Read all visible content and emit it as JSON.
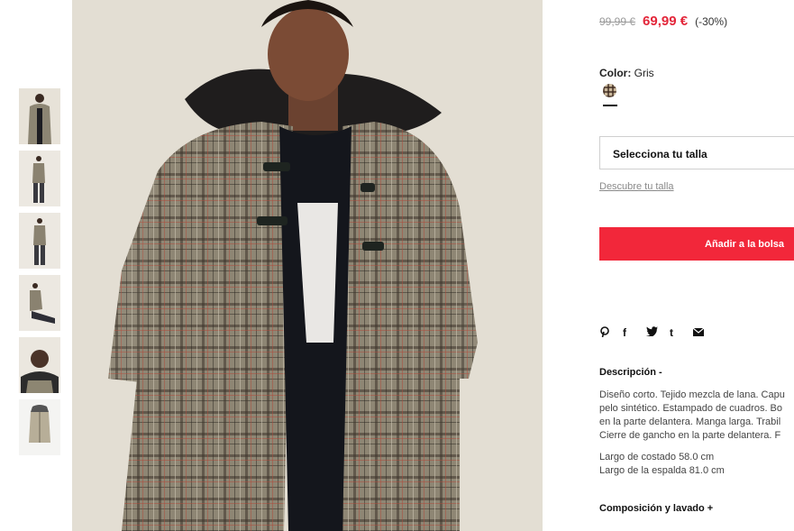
{
  "price": {
    "old": "99,99 €",
    "new": "69,99 €",
    "discount": "(-30%)"
  },
  "color": {
    "label": "Color:",
    "value": "Gris"
  },
  "size": {
    "select_label": "Selecciona tu talla",
    "guide_link": "Descubre tu talla"
  },
  "cart": {
    "add_label": "Añadir a la bolsa"
  },
  "share": {
    "icons": [
      "pinterest-icon",
      "facebook-icon",
      "twitter-icon",
      "tumblr-icon",
      "email-icon"
    ],
    "glyphs": {
      "pinterest": "℗",
      "facebook": "f",
      "twitter": "🐦",
      "tumblr": "t",
      "email": "✉"
    }
  },
  "description": {
    "title": "Descripción -",
    "lines": [
      "Diseño corto. Tejido mezcla de lana. Capu",
      "pelo sintético. Estampado de cuadros. Bo",
      "en la parte delantera. Manga larga. Trabil",
      "Cierre de gancho en la parte delantera. F"
    ],
    "dimension_1": "Largo de costado 58.0 cm",
    "dimension_2": "Largo de la espalda 81.0 cm"
  },
  "composition": {
    "title": "Composición y lavado +"
  },
  "colors": {
    "accent_red": "#f2273a",
    "price_red": "#e3263a"
  }
}
